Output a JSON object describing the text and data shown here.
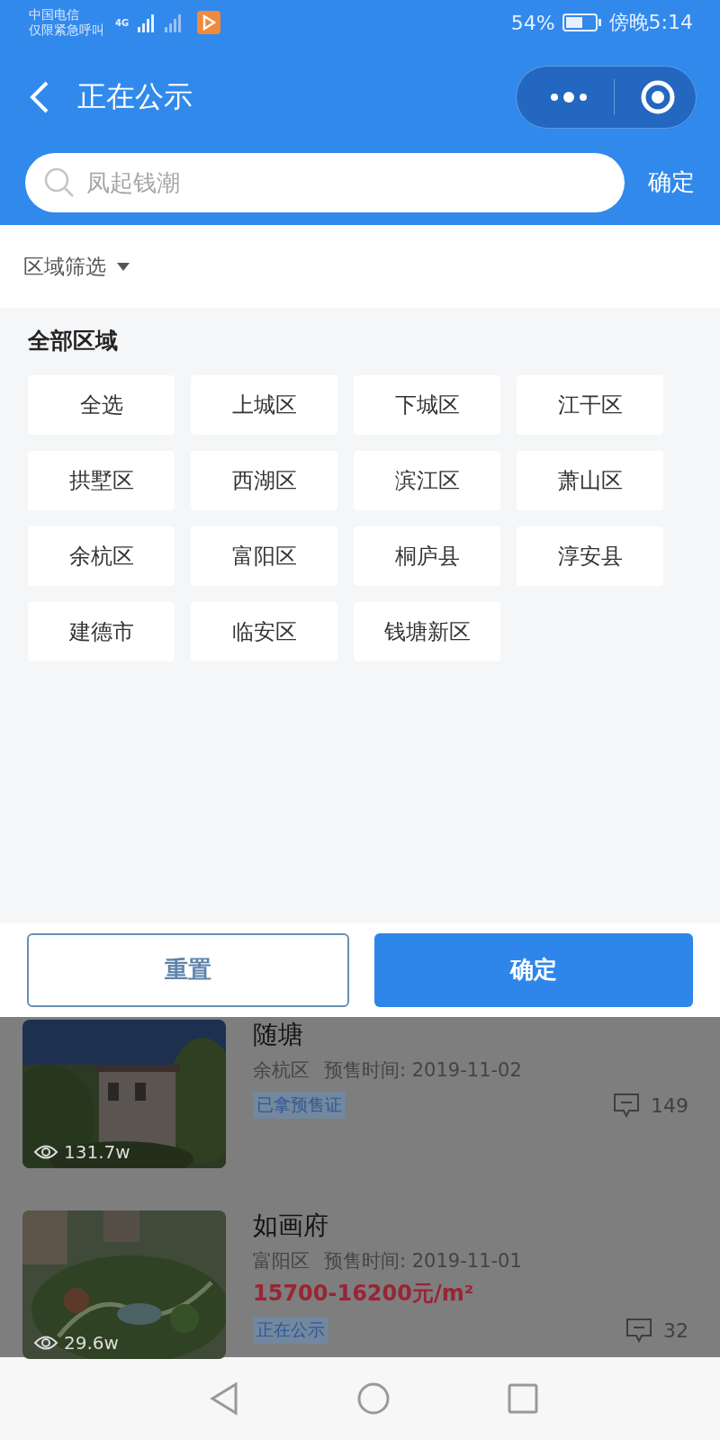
{
  "status_bar": {
    "carrier": "中国电信",
    "carrier_note": "仅限紧急呼叫",
    "network": "4G",
    "battery": "54%",
    "time": "傍晚5:14"
  },
  "header": {
    "title": "正在公示"
  },
  "search": {
    "placeholder": "凤起钱潮",
    "confirm": "确定"
  },
  "filter": {
    "label": "区域筛选"
  },
  "regions": {
    "title": "全部区域",
    "items": [
      {
        "label": "全选",
        "selected": false
      },
      {
        "label": "上城区",
        "selected": false
      },
      {
        "label": "下城区",
        "selected": false
      },
      {
        "label": "江干区",
        "selected": false
      },
      {
        "label": "拱墅区",
        "selected": false
      },
      {
        "label": "西湖区",
        "selected": false
      },
      {
        "label": "滨江区",
        "selected": false
      },
      {
        "label": "萧山区",
        "selected": false
      },
      {
        "label": "余杭区",
        "selected": false
      },
      {
        "label": "富阳区",
        "selected": false
      },
      {
        "label": "桐庐县",
        "selected": false
      },
      {
        "label": "淳安县",
        "selected": false
      },
      {
        "label": "建德市",
        "selected": false
      },
      {
        "label": "临安区",
        "selected": false
      },
      {
        "label": "钱塘新区",
        "selected": false
      }
    ]
  },
  "actions": {
    "reset": "重置",
    "confirm": "确定"
  },
  "listings": [
    {
      "name": "随塘",
      "district": "余杭区",
      "presale": "预售时间: 2019-11-02",
      "tag": "已拿预售证",
      "views": "131.7w",
      "comments": "149"
    },
    {
      "name": "如画府",
      "district": "富阳区",
      "presale": "预售时间: 2019-11-01",
      "price": "15700-16200元/m²",
      "tag": "正在公示",
      "views": "29.6w",
      "comments": "32"
    }
  ]
}
